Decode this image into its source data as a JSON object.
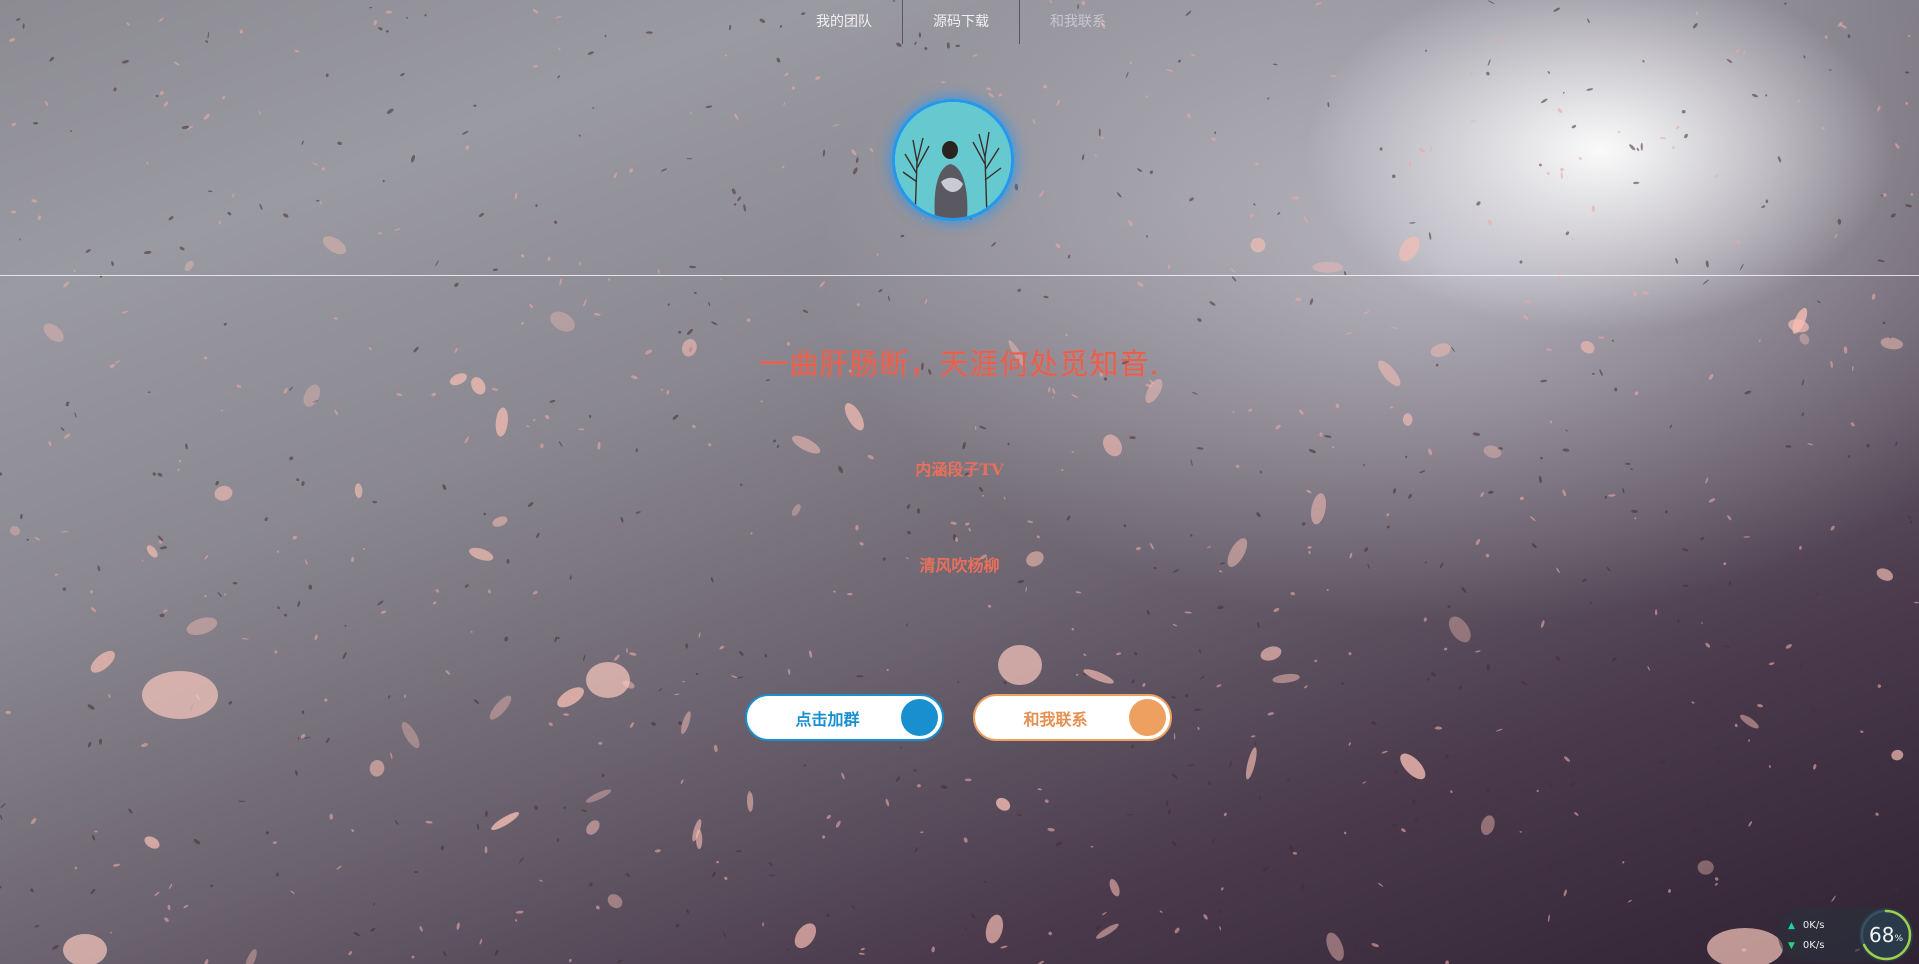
{
  "nav": {
    "items": [
      {
        "label": "我的团队"
      },
      {
        "label": "源码下载"
      },
      {
        "label": "和我联系"
      }
    ]
  },
  "hero": {
    "headline": "一曲肝肠断，天涯何处觅知音.",
    "subtitle_1": "内涵段子TV",
    "subtitle_2": "清风吹杨柳"
  },
  "buttons": {
    "join_label": "点击加群",
    "contact_label": "和我联系"
  },
  "netmon": {
    "upload": "0K/s",
    "download": "0K/s",
    "usage_value": "68",
    "usage_unit": "%"
  },
  "colors": {
    "accent_blue": "#1a8fd0",
    "accent_orange": "#eea060",
    "headline_red": "#e8604c"
  },
  "icons": {
    "upload": "arrow-up-icon",
    "download": "arrow-down-icon"
  }
}
